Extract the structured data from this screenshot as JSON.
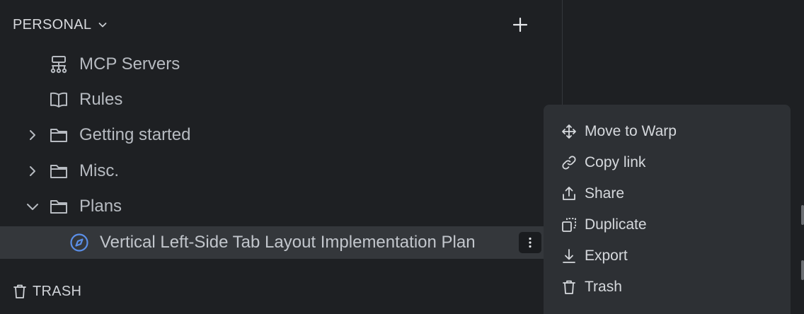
{
  "section": {
    "title": "PERSONAL",
    "add_icon": "plus-icon",
    "toggle_icon": "chevron-down-icon"
  },
  "tree": {
    "items": [
      {
        "label": "MCP Servers",
        "icon": "server-network-icon",
        "expandable": false
      },
      {
        "label": "Rules",
        "icon": "book-icon",
        "expandable": false
      },
      {
        "label": "Getting started",
        "icon": "folder-icon",
        "expandable": true,
        "expanded": false
      },
      {
        "label": "Misc.",
        "icon": "folder-icon",
        "expandable": true,
        "expanded": false
      },
      {
        "label": "Plans",
        "icon": "folder-icon",
        "expandable": true,
        "expanded": true
      }
    ],
    "selected": {
      "label": "Vertical Left-Side Tab Layout Implementation Plan",
      "icon": "compass-icon",
      "menu_icon": "more-vertical-icon"
    }
  },
  "footer": {
    "trash_label": "TRASH",
    "trash_icon": "trash-icon"
  },
  "context_menu": {
    "items": [
      {
        "label": "Move to Warp",
        "icon": "move-icon"
      },
      {
        "label": "Copy link",
        "icon": "link-icon"
      },
      {
        "label": "Share",
        "icon": "share-icon"
      },
      {
        "label": "Duplicate",
        "icon": "duplicate-icon"
      },
      {
        "label": "Export",
        "icon": "download-icon"
      },
      {
        "label": "Trash",
        "icon": "trash-icon"
      }
    ]
  },
  "colors": {
    "background": "#1e2023",
    "selected_row": "#34373b",
    "menu_background": "#2d3034",
    "accent_compass": "#5b8fe8",
    "text": "#b7bbc1"
  }
}
